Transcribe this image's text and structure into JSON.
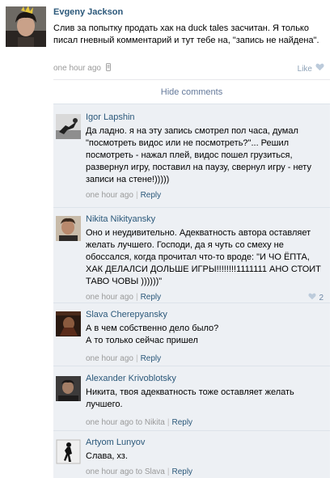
{
  "post": {
    "author": "Evgeny Jackson",
    "text": "Слив за попытку продать хак на duck tales засчитан. Я только писал гневный комментарий и тут тебе на, \"запись не найдена\".",
    "time": "one hour ago",
    "like_label": "Like"
  },
  "hide_comments_label": "Hide comments",
  "comments": [
    {
      "author": "Igor Lapshin",
      "text": "Да ладно. я на эту запись смотрел пол часа, думал \"посмотреть видос или не посмотреть?\"... Решил посмотреть - нажал плей, видос пошел грузиться, развернул игру, поставил на паузу, свернул игру - нету записи на стене!)))))",
      "time": "one hour ago",
      "reply_label": "Reply"
    },
    {
      "author": "Nikita Nikityansky",
      "text": "Оно и неудивительно. Адекватность автора оставляет желать лучшего. Господи, да я чуть со смеху не обоссался, когда прочитал что-то вроде: \"И ЧО ЁПТА, ХАК ДЕЛАЛСИ ДОЛЬШЕ ИГРЫ!!!!!!!!1111111 АНО СТОИТ ТАВО ЧОВЫ ))))))\"",
      "time": "one hour ago",
      "reply_label": "Reply",
      "likes": "2"
    },
    {
      "author": "Slava Cherepyansky",
      "text_line1": "А в чем собственно дело было?",
      "text_line2": "А то только сейчас пришел",
      "time": "one hour ago",
      "reply_label": "Reply"
    },
    {
      "author": "Alexander Krivoblotsky",
      "text": "Никита, твоя адекватность тоже оставляет желать лучшего.",
      "time": "one hour ago",
      "to_label": "to Nikita",
      "reply_label": "Reply"
    },
    {
      "author": "Artyom Lunyov",
      "text": "Слава, хз.",
      "time": "one hour ago",
      "to_label": "to Slava",
      "reply_label": "Reply"
    }
  ],
  "colors": {
    "link": "#2b587a",
    "meta": "#999999",
    "comments_bg": "#edf0f4"
  }
}
